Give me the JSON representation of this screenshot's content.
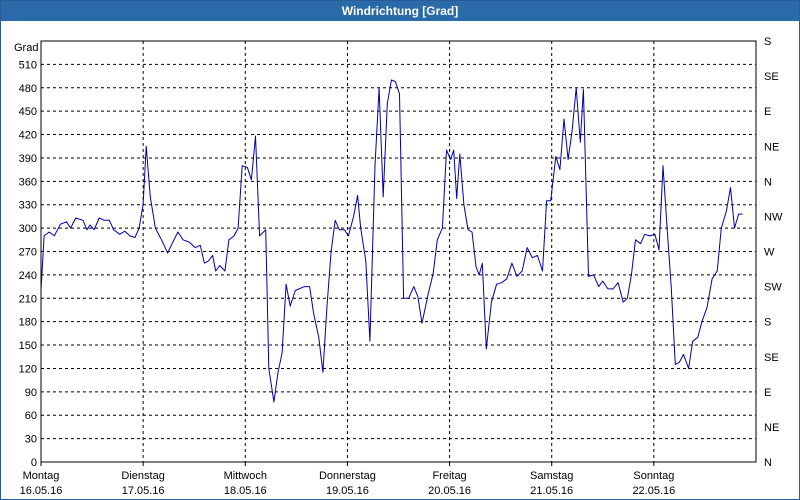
{
  "window": {
    "title": "Windrichtung [Grad]"
  },
  "chart_data": {
    "type": "line",
    "title": "Windrichtung [Grad]",
    "ylabel": "Grad",
    "xlabel": "",
    "ylim": [
      0,
      540
    ],
    "xlim": [
      0,
      7
    ],
    "y_ticks": [
      0,
      30,
      60,
      90,
      120,
      150,
      180,
      210,
      240,
      270,
      300,
      330,
      360,
      390,
      420,
      450,
      480,
      510
    ],
    "right_ticks": [
      {
        "y": 0,
        "label": "N"
      },
      {
        "y": 45,
        "label": "NE"
      },
      {
        "y": 90,
        "label": "E"
      },
      {
        "y": 135,
        "label": "SE"
      },
      {
        "y": 180,
        "label": "S"
      },
      {
        "y": 225,
        "label": "SW"
      },
      {
        "y": 270,
        "label": "W"
      },
      {
        "y": 315,
        "label": "NW"
      },
      {
        "y": 360,
        "label": "N"
      },
      {
        "y": 405,
        "label": "NE"
      },
      {
        "y": 450,
        "label": "E"
      },
      {
        "y": 495,
        "label": "SE"
      },
      {
        "y": 540,
        "label": "S"
      }
    ],
    "x_ticks": [
      {
        "x": 0,
        "day": "Montag",
        "date": "16.05.16"
      },
      {
        "x": 1,
        "day": "Dienstag",
        "date": "17.05.16"
      },
      {
        "x": 2,
        "day": "Mittwoch",
        "date": "18.05.16"
      },
      {
        "x": 3,
        "day": "Donnerstag",
        "date": "19.05.16"
      },
      {
        "x": 4,
        "day": "Freitag",
        "date": "20.05.16"
      },
      {
        "x": 5,
        "day": "Samstag",
        "date": "21.05.16"
      },
      {
        "x": 6,
        "day": "Sonntag",
        "date": "22.05.16"
      }
    ],
    "grid": true,
    "line_color": "#0000aa",
    "series": [
      {
        "name": "",
        "points": [
          [
            0.0,
            220
          ],
          [
            0.03,
            290
          ],
          [
            0.08,
            295
          ],
          [
            0.13,
            290
          ],
          [
            0.19,
            305
          ],
          [
            0.25,
            308
          ],
          [
            0.29,
            300
          ],
          [
            0.34,
            313
          ],
          [
            0.41,
            310
          ],
          [
            0.45,
            298
          ],
          [
            0.48,
            304
          ],
          [
            0.52,
            298
          ],
          [
            0.57,
            313
          ],
          [
            0.62,
            310
          ],
          [
            0.67,
            310
          ],
          [
            0.71,
            298
          ],
          [
            0.77,
            292
          ],
          [
            0.82,
            296
          ],
          [
            0.87,
            290
          ],
          [
            0.92,
            288
          ],
          [
            0.96,
            300
          ],
          [
            1.0,
            330
          ],
          [
            1.03,
            405
          ],
          [
            1.07,
            340
          ],
          [
            1.12,
            300
          ],
          [
            1.18,
            285
          ],
          [
            1.24,
            268
          ],
          [
            1.29,
            282
          ],
          [
            1.34,
            295
          ],
          [
            1.39,
            285
          ],
          [
            1.45,
            282
          ],
          [
            1.51,
            275
          ],
          [
            1.56,
            278
          ],
          [
            1.6,
            255
          ],
          [
            1.64,
            258
          ],
          [
            1.68,
            265
          ],
          [
            1.71,
            245
          ],
          [
            1.75,
            252
          ],
          [
            1.8,
            245
          ],
          [
            1.84,
            285
          ],
          [
            1.89,
            290
          ],
          [
            1.93,
            300
          ],
          [
            1.97,
            380
          ],
          [
            2.02,
            378
          ],
          [
            2.06,
            362
          ],
          [
            2.1,
            418
          ],
          [
            2.14,
            290
          ],
          [
            2.2,
            298
          ],
          [
            2.23,
            120
          ],
          [
            2.28,
            77
          ],
          [
            2.32,
            115
          ],
          [
            2.36,
            140
          ],
          [
            2.4,
            228
          ],
          [
            2.44,
            200
          ],
          [
            2.49,
            220
          ],
          [
            2.58,
            225
          ],
          [
            2.63,
            225
          ],
          [
            2.67,
            190
          ],
          [
            2.72,
            160
          ],
          [
            2.76,
            115
          ],
          [
            2.8,
            200
          ],
          [
            2.84,
            270
          ],
          [
            2.88,
            310
          ],
          [
            2.92,
            298
          ],
          [
            2.97,
            298
          ],
          [
            3.01,
            290
          ],
          [
            3.06,
            315
          ],
          [
            3.1,
            342
          ],
          [
            3.13,
            300
          ],
          [
            3.18,
            258
          ],
          [
            3.22,
            155
          ],
          [
            3.27,
            380
          ],
          [
            3.31,
            480
          ],
          [
            3.35,
            340
          ],
          [
            3.39,
            460
          ],
          [
            3.43,
            490
          ],
          [
            3.47,
            488
          ],
          [
            3.51,
            472
          ],
          [
            3.55,
            210
          ],
          [
            3.6,
            210
          ],
          [
            3.65,
            225
          ],
          [
            3.69,
            212
          ],
          [
            3.73,
            178
          ],
          [
            3.79,
            215
          ],
          [
            3.84,
            242
          ],
          [
            3.88,
            285
          ],
          [
            3.93,
            300
          ],
          [
            3.97,
            400
          ],
          [
            4.01,
            388
          ],
          [
            4.04,
            400
          ],
          [
            4.07,
            338
          ],
          [
            4.1,
            395
          ],
          [
            4.14,
            330
          ],
          [
            4.18,
            298
          ],
          [
            4.22,
            295
          ],
          [
            4.26,
            250
          ],
          [
            4.29,
            240
          ],
          [
            4.32,
            255
          ],
          [
            4.36,
            145
          ],
          [
            4.41,
            205
          ],
          [
            4.46,
            228
          ],
          [
            4.51,
            230
          ],
          [
            4.56,
            235
          ],
          [
            4.61,
            255
          ],
          [
            4.66,
            238
          ],
          [
            4.71,
            245
          ],
          [
            4.76,
            275
          ],
          [
            4.81,
            262
          ],
          [
            4.86,
            265
          ],
          [
            4.91,
            245
          ],
          [
            4.95,
            335
          ],
          [
            4.99,
            335
          ],
          [
            5.04,
            392
          ],
          [
            5.08,
            375
          ],
          [
            5.12,
            440
          ],
          [
            5.16,
            388
          ],
          [
            5.2,
            425
          ],
          [
            5.24,
            480
          ],
          [
            5.28,
            410
          ],
          [
            5.31,
            478
          ],
          [
            5.36,
            238
          ],
          [
            5.41,
            240
          ],
          [
            5.46,
            225
          ],
          [
            5.5,
            232
          ],
          [
            5.55,
            222
          ],
          [
            5.6,
            222
          ],
          [
            5.65,
            230
          ],
          [
            5.7,
            205
          ],
          [
            5.74,
            210
          ],
          [
            5.78,
            240
          ],
          [
            5.82,
            285
          ],
          [
            5.87,
            280
          ],
          [
            5.91,
            292
          ],
          [
            5.96,
            290
          ],
          [
            6.01,
            292
          ],
          [
            6.05,
            272
          ],
          [
            6.09,
            380
          ],
          [
            6.13,
            300
          ],
          [
            6.17,
            225
          ],
          [
            6.21,
            125
          ],
          [
            6.25,
            128
          ],
          [
            6.29,
            138
          ],
          [
            6.34,
            120
          ],
          [
            6.38,
            155
          ],
          [
            6.43,
            160
          ],
          [
            6.47,
            180
          ],
          [
            6.52,
            198
          ],
          [
            6.57,
            235
          ],
          [
            6.62,
            245
          ],
          [
            6.66,
            300
          ],
          [
            6.71,
            322
          ],
          [
            6.75,
            352
          ],
          [
            6.79,
            300
          ],
          [
            6.83,
            318
          ],
          [
            6.87,
            318
          ]
        ]
      }
    ]
  }
}
